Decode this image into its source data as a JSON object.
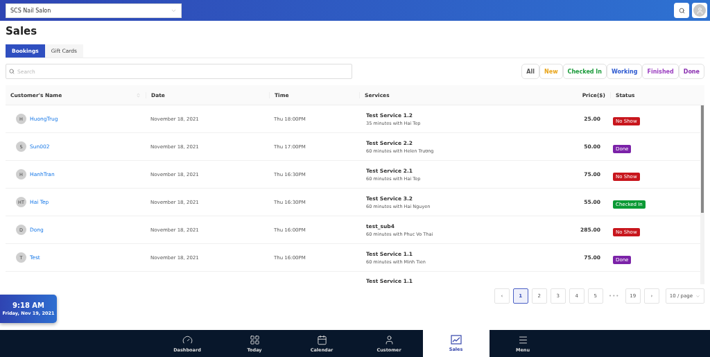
{
  "header": {
    "salon_select": {
      "value": "SCS Nail Salon"
    }
  },
  "page_title": "Sales",
  "tabs": [
    {
      "label": "Bookings",
      "selected": true
    },
    {
      "label": "Gift Cards",
      "selected": false
    }
  ],
  "search": {
    "placeholder": "Search"
  },
  "filters": [
    {
      "label": "All",
      "color": "#555555"
    },
    {
      "label": "New",
      "color": "#e8a317"
    },
    {
      "label": "Checked In",
      "color": "#1a9a3a"
    },
    {
      "label": "Working",
      "color": "#2f5bd1"
    },
    {
      "label": "Finished",
      "color": "#9b3fc0"
    },
    {
      "label": "Done",
      "color": "#8a2fb0"
    }
  ],
  "table": {
    "columns": [
      "Customer's Name",
      "Date",
      "Time",
      "Services",
      "Price($)",
      "Status"
    ],
    "rows": [
      {
        "initials": "H",
        "name": "HuongTrug",
        "date": "November 18, 2021",
        "time": "Thu 18:00PM",
        "service": "Test Service 1.2",
        "detail": "35 minutes with Hai Tep",
        "price": "25.00",
        "status": {
          "label": "No Show",
          "color": "#c8161d"
        }
      },
      {
        "initials": "S",
        "name": "Sun002",
        "date": "November 18, 2021",
        "time": "Thu 17:00PM",
        "service": "Test Service 2.2",
        "detail": "60 minutes with Helen Trương",
        "price": "50.00",
        "status": {
          "label": "Done",
          "color": "#7b22a8"
        }
      },
      {
        "initials": "H",
        "name": "HanhTran",
        "date": "November 18, 2021",
        "time": "Thu 16:30PM",
        "service": "Test Service 2.1",
        "detail": "60 minutes with Hai Tep",
        "price": "75.00",
        "status": {
          "label": "No Show",
          "color": "#c8161d"
        }
      },
      {
        "initials": "HT",
        "name": "Hai Tep",
        "date": "November 18, 2021",
        "time": "Thu 16:30PM",
        "service": "Test Service 3.2",
        "detail": "60 minutes with Hai Nguyen",
        "price": "55.00",
        "status": {
          "label": "Checked In",
          "color": "#0b9a35"
        }
      },
      {
        "initials": "D",
        "name": "Dong",
        "date": "November 18, 2021",
        "time": "Thu 16:00PM",
        "service": "test_sub4",
        "detail": "60 minutes with Phuc Vo Thai",
        "price": "285.00",
        "status": {
          "label": "No Show",
          "color": "#c8161d"
        }
      },
      {
        "initials": "T",
        "name": "Test",
        "date": "November 18, 2021",
        "time": "Thu 16:00PM",
        "service": "Test Service 1.1",
        "detail": "60 minutes with Minh Tien",
        "price": "75.00",
        "status": {
          "label": "Done",
          "color": "#7b22a8"
        }
      },
      {
        "service": "Test Service 1.1"
      }
    ]
  },
  "pagination": {
    "prev": "‹",
    "pages": [
      {
        "label": "1",
        "selected": true
      },
      {
        "label": "2",
        "selected": false
      },
      {
        "label": "3",
        "selected": false
      },
      {
        "label": "4",
        "selected": false
      },
      {
        "label": "5",
        "selected": false
      },
      {
        "label": "•••",
        "kind": "ellipsis"
      },
      {
        "label": "19",
        "selected": false
      }
    ],
    "next": "›",
    "page_size": "10 / page"
  },
  "clock": {
    "time": "9:18 AM",
    "date": "Friday, Nov 19, 2021"
  },
  "bottom_nav": [
    {
      "label": "Dashboard",
      "selected": false
    },
    {
      "label": "Today",
      "selected": false
    },
    {
      "label": "Calendar",
      "selected": false
    },
    {
      "label": "Customer",
      "selected": false
    },
    {
      "label": "Sales",
      "selected": true
    },
    {
      "label": "Menu",
      "selected": false
    }
  ]
}
